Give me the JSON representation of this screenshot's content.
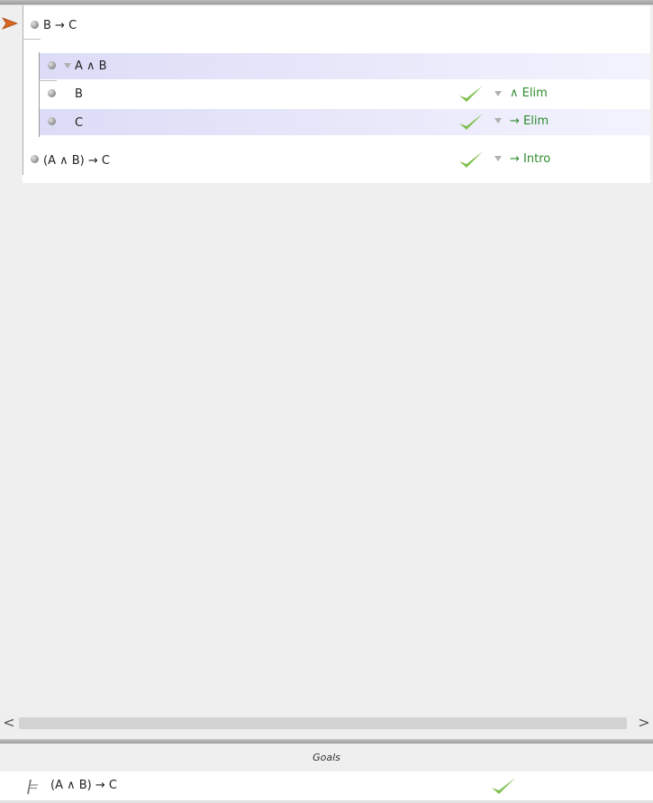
{
  "proof": {
    "current_line_marker": "arrow-right",
    "lines": [
      {
        "formula": "B → C",
        "justified": false,
        "rule": ""
      },
      {
        "formula": "A ∧ B",
        "justified": false,
        "rule": ""
      },
      {
        "formula": "B",
        "justified": true,
        "rule": "∧ Elim"
      },
      {
        "formula": "C",
        "justified": true,
        "rule": "→ Elim"
      },
      {
        "formula": "(A ∧ B) → C",
        "justified": true,
        "rule": "→ Intro"
      }
    ]
  },
  "scrollbar": {
    "left_glyph": "<",
    "right_glyph": ">"
  },
  "goals": {
    "header": "Goals",
    "items": [
      {
        "icon": "turnstile-icon",
        "formula": "(A ∧ B) → C",
        "status": "check"
      }
    ]
  },
  "colors": {
    "highlight_row": "#e7e7fb",
    "check_green": "#7fbf4f",
    "rule_text": "#2e8b2e",
    "arrow_orange": "#d9661f"
  }
}
